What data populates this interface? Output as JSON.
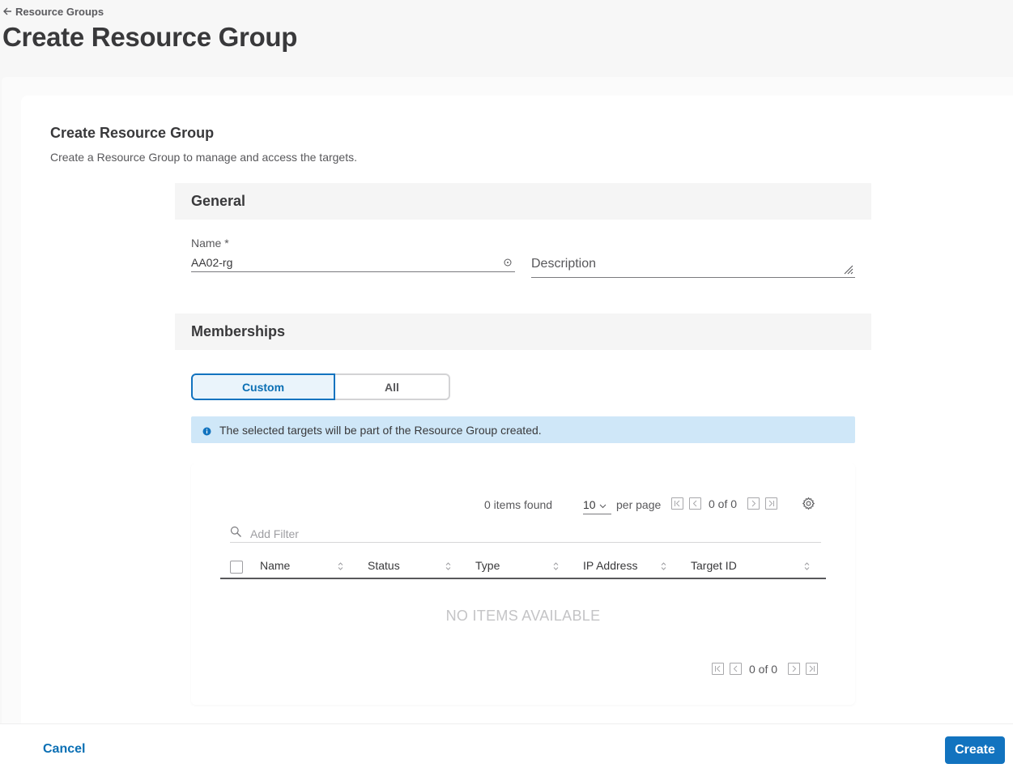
{
  "breadcrumb": {
    "back_label": "Resource Groups"
  },
  "page": {
    "title": "Create Resource Group"
  },
  "form": {
    "title": "Create Resource Group",
    "subtitle": "Create a Resource Group to manage and access the targets.",
    "general": {
      "header": "General",
      "name_label": "Name *",
      "name_value": "AA02-rg",
      "description_placeholder": "Description"
    },
    "memberships": {
      "header": "Memberships",
      "segments": [
        "Custom",
        "All"
      ],
      "selected_segment": "Custom",
      "alert_text": "The selected targets will be part of the Resource Group created."
    }
  },
  "table": {
    "items_found": "0 items found",
    "per_page_value": "10",
    "per_page_label": "per page",
    "pager_top": "0 of 0",
    "pager_bottom": "0 of 0",
    "filter_placeholder": "Add Filter",
    "columns": [
      "Name",
      "Status",
      "Type",
      "IP Address",
      "Target ID"
    ],
    "empty_message": "NO ITEMS AVAILABLE"
  },
  "footer": {
    "cancel_label": "Cancel",
    "create_label": "Create"
  },
  "colors": {
    "accent": "#1273bf",
    "alert_bg": "#cfe7f8",
    "panel_bg": "#f5f5f5"
  }
}
